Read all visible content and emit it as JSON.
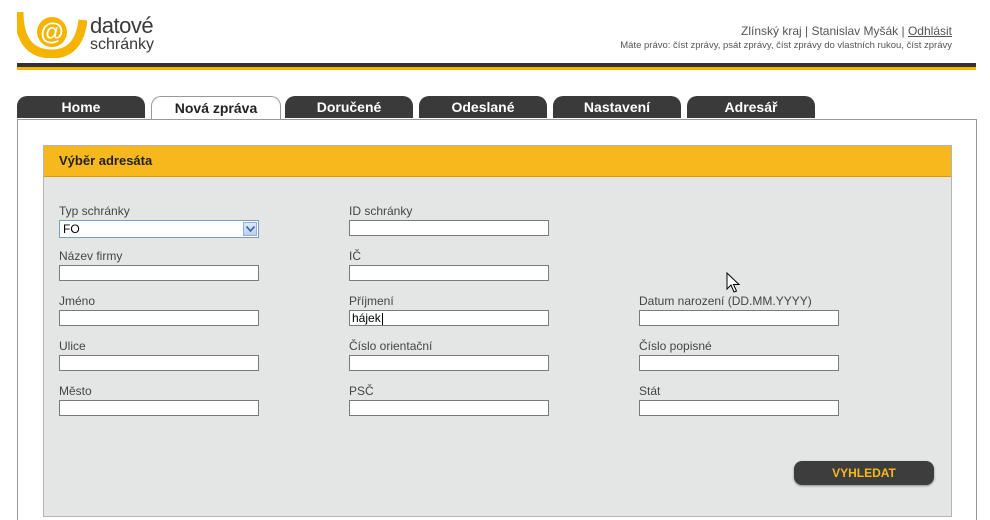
{
  "brand": {
    "line1": "datové",
    "line2": "schránky",
    "icon": "at-sign-logo-icon",
    "accent": "#f4b400"
  },
  "header": {
    "region": "Zlínský kraj",
    "sep1": " | ",
    "user": "Stanislav Myšák",
    "sep2": " | ",
    "logout": "Odhlásit",
    "rights": "Máte právo: číst zprávy, psát zprávy, číst zprávy do vlastních rukou, číst zprávy"
  },
  "tabs": [
    {
      "label": "Home"
    },
    {
      "label": "Nová zpráva"
    },
    {
      "label": "Doručené"
    },
    {
      "label": "Odeslané"
    },
    {
      "label": "Nastavení"
    },
    {
      "label": "Adresář"
    }
  ],
  "panel": {
    "title": "Výběr adresáta",
    "fields": {
      "typ": {
        "label": "Typ schránky",
        "value": "FO"
      },
      "id": {
        "label": "ID schránky",
        "value": ""
      },
      "firma": {
        "label": "Název firmy",
        "value": ""
      },
      "ic": {
        "label": "IČ",
        "value": ""
      },
      "jmeno": {
        "label": "Jméno",
        "value": ""
      },
      "prijmeni": {
        "label": "Příjmení",
        "value": "hájek"
      },
      "datum": {
        "label": "Datum narození (DD.MM.YYYY)",
        "value": ""
      },
      "ulice": {
        "label": "Ulice",
        "value": ""
      },
      "orient": {
        "label": "Číslo orientační",
        "value": ""
      },
      "popisne": {
        "label": "Číslo popisné",
        "value": ""
      },
      "mesto": {
        "label": "Město",
        "value": ""
      },
      "psc": {
        "label": "PSČ",
        "value": ""
      },
      "stat": {
        "label": "Stát",
        "value": ""
      }
    },
    "search_button": "VYHLEDAT"
  }
}
